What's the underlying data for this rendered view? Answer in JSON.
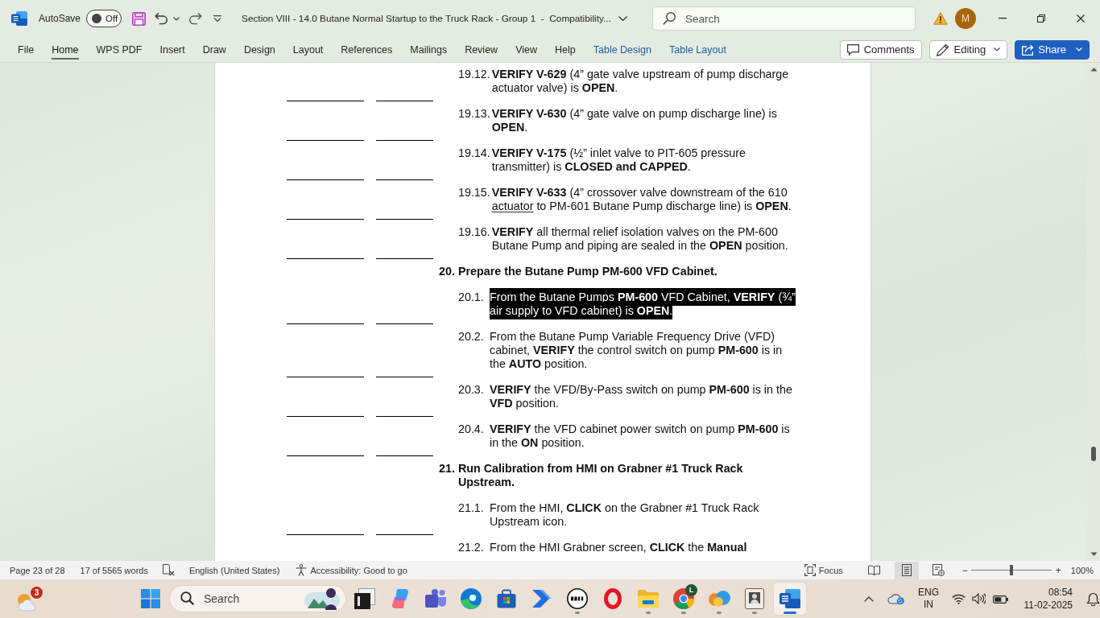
{
  "titlebar": {
    "autosave": {
      "label": "AutoSave",
      "state": "Off",
      "on": false
    },
    "title": "Section VIII - 14.0 Butane Normal Startup to the Truck Rack - Group 1  -  Compatibility...",
    "search": {
      "placeholder": "Search"
    },
    "avatar": "M"
  },
  "ribbon": {
    "tabs": [
      {
        "label": "File",
        "selected": false,
        "contextual": false
      },
      {
        "label": "Home",
        "selected": true,
        "contextual": false
      },
      {
        "label": "WPS PDF",
        "selected": false,
        "contextual": false
      },
      {
        "label": "Insert",
        "selected": false,
        "contextual": false
      },
      {
        "label": "Draw",
        "selected": false,
        "contextual": false
      },
      {
        "label": "Design",
        "selected": false,
        "contextual": false
      },
      {
        "label": "Layout",
        "selected": false,
        "contextual": false
      },
      {
        "label": "References",
        "selected": false,
        "contextual": false
      },
      {
        "label": "Mailings",
        "selected": false,
        "contextual": false
      },
      {
        "label": "Review",
        "selected": false,
        "contextual": false
      },
      {
        "label": "View",
        "selected": false,
        "contextual": false
      },
      {
        "label": "Help",
        "selected": false,
        "contextual": false
      },
      {
        "label": "Table Design",
        "selected": false,
        "contextual": true
      },
      {
        "label": "Table Layout",
        "selected": false,
        "contextual": true
      }
    ],
    "comments": "Comments",
    "editing": "Editing",
    "share": "Share"
  },
  "document": {
    "items": [
      {
        "kind": "step",
        "number": "19.12.",
        "runs": [
          {
            "text": "**VERIFY V-629** (4” gate valve upstream of pump discharge actuator valve) is **OPEN**."
          }
        ],
        "selected": false,
        "signoff_blanks": true
      },
      {
        "kind": "step",
        "number": "19.13.",
        "runs": [
          {
            "text": "**VERIFY V-630** (4” gate valve on pump discharge line) is **OPEN**."
          }
        ],
        "selected": false,
        "signoff_blanks": true
      },
      {
        "kind": "step",
        "number": "19.14.",
        "runs": [
          {
            "text": "**VERIFY V-175** (½” inlet valve to PIT-605 pressure transmitter) is **CLOSED and CAPPED**."
          }
        ],
        "selected": false,
        "signoff_blanks": true
      },
      {
        "kind": "step",
        "number": "19.15.",
        "runs": [
          {
            "text": "**VERIFY V-633** (4” crossover valve downstream of the 610 "
          },
          {
            "text": "actuator",
            "underlined": true
          },
          {
            "text": " to PM-601 Butane Pump discharge line) is **OPEN**."
          }
        ],
        "selected": false,
        "signoff_blanks": true
      },
      {
        "kind": "step",
        "number": "19.16.",
        "runs": [
          {
            "text": "**VERIFY** all thermal relief isolation valves on the PM-600 Butane Pump and piping are sealed in the **OPEN** position."
          }
        ],
        "selected": false,
        "signoff_blanks": true
      },
      {
        "kind": "section",
        "number": "20.",
        "runs": [
          {
            "text": "Prepare the Butane Pump PM-600 VFD Cabinet."
          }
        ],
        "selected": false
      },
      {
        "kind": "step",
        "number": "20.1.",
        "runs": [
          {
            "text": "From the Butane Pumps **PM-600** VFD Cabinet, **VERIFY** (¾” air supply to VFD cabinet) is **OPEN**."
          }
        ],
        "selected": true,
        "signoff_blanks": true
      },
      {
        "kind": "step",
        "number": "20.2.",
        "runs": [
          {
            "text": "From the Butane Pump Variable Frequency Drive (VFD) cabinet, **VERIFY** the control switch on pump **PM-600** is in the **AUTO** position."
          }
        ],
        "selected": false,
        "signoff_blanks": true
      },
      {
        "kind": "step",
        "number": "20.3.",
        "runs": [
          {
            "text": "**VERIFY** the VFD/By-Pass switch on pump **PM-600** is in the **VFD** position."
          }
        ],
        "selected": false,
        "signoff_blanks": true
      },
      {
        "kind": "step",
        "number": "20.4.",
        "runs": [
          {
            "text": "**VERIFY** the VFD cabinet power switch on pump **PM-600** is in the **ON** position."
          }
        ],
        "selected": false,
        "signoff_blanks": true
      },
      {
        "kind": "section",
        "number": "21.",
        "runs": [
          {
            "text": "Run Calibration from HMI on Grabner #1 Truck Rack Upstream."
          }
        ],
        "selected": false
      },
      {
        "kind": "step",
        "number": "21.1.",
        "runs": [
          {
            "text": "From the HMI, **CLICK** on the Grabner #1 Truck Rack Upstream icon."
          }
        ],
        "selected": false,
        "signoff_blanks": true
      },
      {
        "kind": "step",
        "number": "21.2.",
        "runs": [
          {
            "text": "From the HMI Grabner screen, **CLICK** the **Manual**"
          }
        ],
        "selected": false,
        "signoff_blanks": false
      }
    ]
  },
  "status_bar": {
    "page": "Page 23 of 28",
    "words": "17 of 5565 words",
    "language": "English (United States)",
    "accessibility": "Accessibility: Good to go",
    "focus": "Focus",
    "views": [
      {
        "kind": "read",
        "selected": false
      },
      {
        "kind": "print",
        "selected": true
      },
      {
        "kind": "web",
        "selected": false
      }
    ],
    "zoom": {
      "minus": "−",
      "plus": "+",
      "level": 0.5,
      "reading": "100%"
    }
  },
  "taskbar": {
    "weather_badge": "3",
    "search": {
      "placeholder": "Search"
    },
    "apps": [
      {
        "kind": "task-view",
        "running": false,
        "selected": false
      },
      {
        "kind": "copilot",
        "running": false,
        "selected": false
      },
      {
        "kind": "teams",
        "running": false,
        "selected": false
      },
      {
        "kind": "edge",
        "running": false,
        "selected": false
      },
      {
        "kind": "store",
        "running": false,
        "selected": false
      },
      {
        "kind": "automate",
        "running": false,
        "selected": false
      },
      {
        "kind": "dell",
        "running": true,
        "selected": false
      },
      {
        "kind": "opera",
        "running": false,
        "selected": false
      },
      {
        "kind": "explorer",
        "running": true,
        "selected": false
      },
      {
        "kind": "chrome",
        "running": true,
        "selected": false,
        "badge": "L"
      },
      {
        "kind": "cloud-app",
        "running": true,
        "selected": false
      },
      {
        "kind": "viewer",
        "running": true,
        "selected": false
      },
      {
        "kind": "word",
        "running": true,
        "selected": true
      }
    ],
    "tray": {
      "language": "ENG",
      "region": "IN",
      "time": "08:54",
      "date": "11-02-2025"
    }
  }
}
